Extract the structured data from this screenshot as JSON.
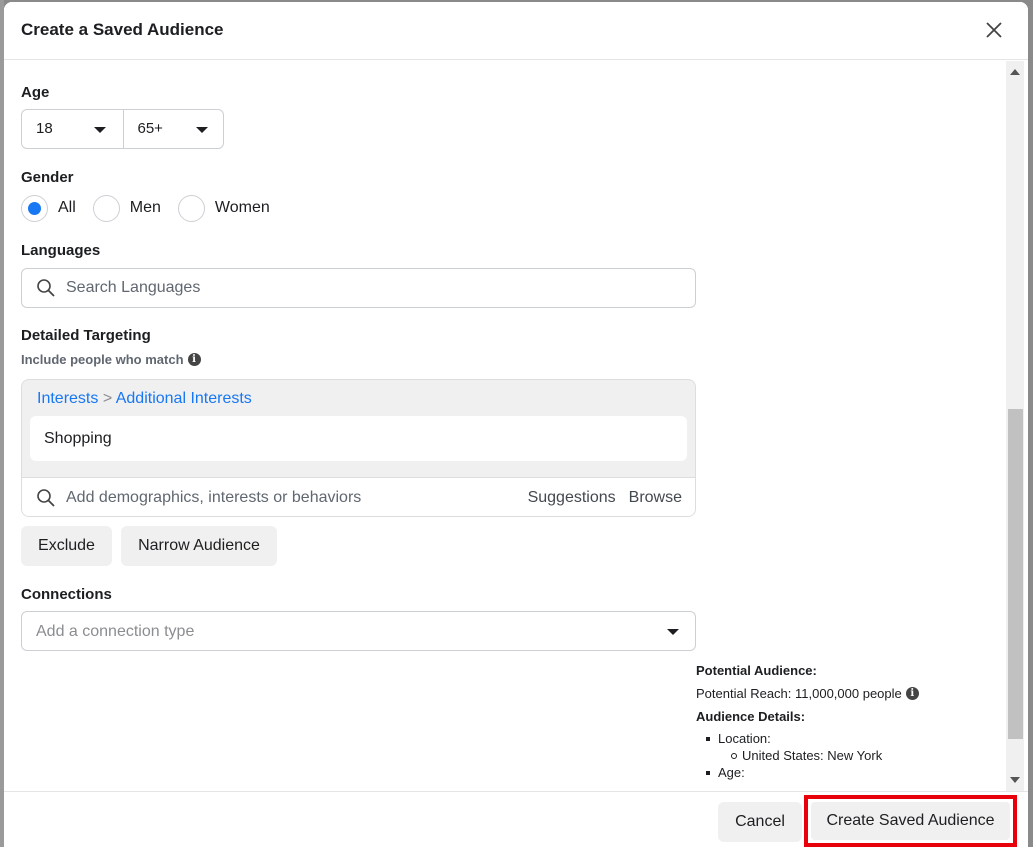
{
  "modal": {
    "title": "Create a Saved Audience",
    "close_icon": "close-icon"
  },
  "age": {
    "label": "Age",
    "min": "18",
    "max": "65+"
  },
  "gender": {
    "label": "Gender",
    "options": [
      {
        "label": "All",
        "checked": true
      },
      {
        "label": "Men",
        "checked": false
      },
      {
        "label": "Women",
        "checked": false
      }
    ]
  },
  "languages": {
    "label": "Languages",
    "placeholder": "Search Languages",
    "value": ""
  },
  "detailed_targeting": {
    "label": "Detailed Targeting",
    "sublabel": "Include people who match",
    "breadcrumb": {
      "part1": "Interests",
      "separator": ">",
      "part2": "Additional Interests"
    },
    "selected": [
      "Shopping"
    ],
    "search_placeholder": "Add demographics, interests or behaviors",
    "suggestions_label": "Suggestions",
    "browse_label": "Browse",
    "exclude_label": "Exclude",
    "narrow_label": "Narrow Audience"
  },
  "connections": {
    "label": "Connections",
    "placeholder": "Add a connection type"
  },
  "audience": {
    "title": "Potential Audience:",
    "reach": "Potential Reach: 11,000,000 people",
    "details_title": "Audience Details:",
    "location_label": "Location:",
    "location_value": "United States: New York",
    "age_label": "Age:"
  },
  "footer": {
    "cancel_label": "Cancel",
    "create_label": "Create Saved Audience"
  },
  "colors": {
    "accent": "#1877f2",
    "highlight": "#e8000b"
  },
  "scroll": {
    "position_fraction": 0.55
  }
}
